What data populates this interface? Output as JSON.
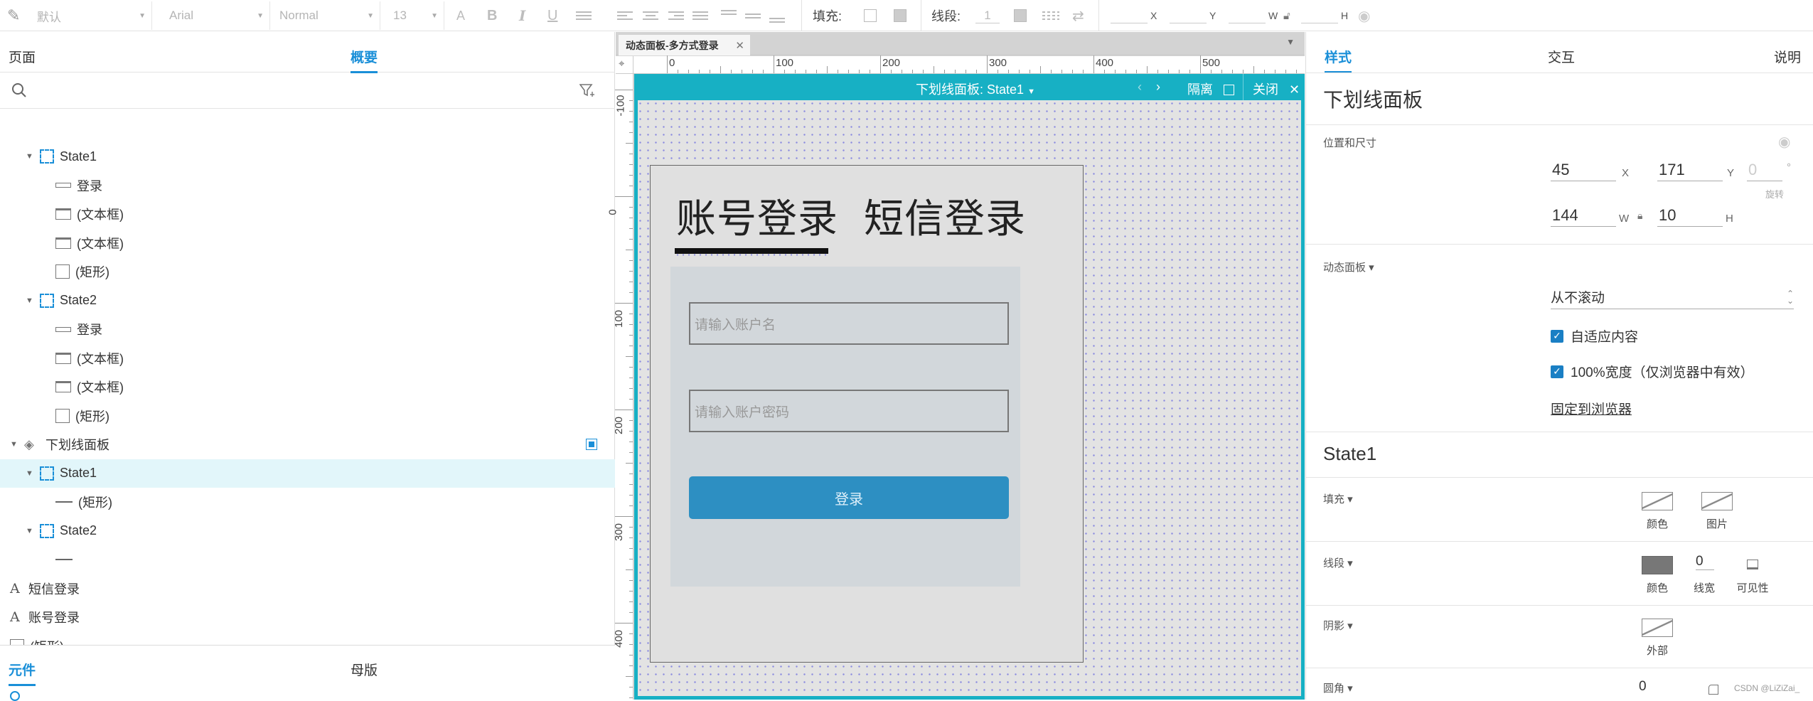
{
  "toolbar": {
    "style_select": "默认",
    "font_select": "Arial",
    "weight_select": "Normal",
    "size_select": "13",
    "fill_label": "填充:",
    "stroke_label": "线段:",
    "stroke_width": "1",
    "x_label": "X",
    "y_label": "Y",
    "w_label": "W",
    "h_label": "H"
  },
  "left": {
    "tabs": [
      "页面",
      "概要"
    ],
    "tree": [
      {
        "label": "State1",
        "type": "state",
        "indent": 1
      },
      {
        "label": "登录",
        "type": "button",
        "indent": 2
      },
      {
        "label": "(文本框)",
        "type": "field",
        "indent": 2
      },
      {
        "label": "(文本框)",
        "type": "field",
        "indent": 2
      },
      {
        "label": "(矩形)",
        "type": "rect",
        "indent": 2
      },
      {
        "label": "State2",
        "type": "state",
        "indent": 1
      },
      {
        "label": "登录",
        "type": "button",
        "indent": 2
      },
      {
        "label": "(文本框)",
        "type": "field",
        "indent": 2
      },
      {
        "label": "(文本框)",
        "type": "field",
        "indent": 2
      },
      {
        "label": "(矩形)",
        "type": "rect",
        "indent": 2
      },
      {
        "label": "下划线面板",
        "type": "panel",
        "indent": 0
      },
      {
        "label": "State1",
        "type": "state",
        "indent": 1,
        "selected": true
      },
      {
        "label": "(矩形)",
        "type": "line",
        "indent": 2
      },
      {
        "label": "State2",
        "type": "state",
        "indent": 1
      },
      {
        "label": "",
        "type": "line",
        "indent": 2
      },
      {
        "label": "短信登录",
        "type": "text",
        "indent": 0
      },
      {
        "label": "账号登录",
        "type": "text",
        "indent": 0
      },
      {
        "label": "(矩形)",
        "type": "rect",
        "indent": 0
      }
    ],
    "bottom_tabs": [
      "元件",
      "母版"
    ]
  },
  "canvas": {
    "doc_tab": "动态面板-多方式登录",
    "h_ruler": [
      "0",
      "100",
      "200",
      "300",
      "400",
      "500"
    ],
    "v_ruler": [
      "-100",
      "0",
      "100",
      "200",
      "300",
      "400"
    ],
    "panel_title": "下划线面板:  State1",
    "isolate_label": "隔离",
    "close_label": "关闭",
    "tab_account": "账号登录",
    "tab_sms": "短信登录",
    "username_placeholder": "请输入账户名",
    "password_placeholder": "请输入账户密码",
    "login_button": "登录"
  },
  "right": {
    "tabs": [
      "样式",
      "交互",
      "说明"
    ],
    "title": "下划线面板",
    "pos_size_label": "位置和尺寸",
    "x": "45",
    "y": "171",
    "rotate": "0",
    "rotate_label": "旋转",
    "w": "144",
    "h": "10",
    "dynamic_panel_label": "动态面板 ▾",
    "scroll_option": "从不滚动",
    "fit_content": "自适应内容",
    "full_width": "100%宽度（仅浏览器中有效）",
    "pin_to_browser": "固定到浏览器",
    "state_title": "State1",
    "fill_label": "填充 ▾",
    "color_label": "颜色",
    "image_label": "图片",
    "stroke_label": "线段 ▾",
    "stroke_color_label": "颜色",
    "stroke_width_value": "0",
    "stroke_width_label": "线宽",
    "visibility_label": "可见性",
    "shadow_label": "阴影 ▾",
    "outer_label": "外部",
    "corner_label": "圆角 ▾",
    "corner_value": "0",
    "watermark": "CSDN @LiZiZai_"
  },
  "colors": {
    "accent": "#1a8fd8",
    "panel_teal": "#17b0c4",
    "login_button": "#2d8fc2",
    "selected_row": "#e2f6fa"
  }
}
